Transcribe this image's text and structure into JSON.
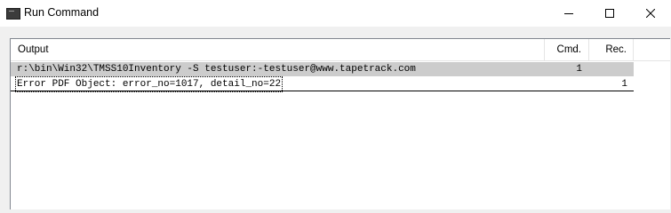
{
  "window": {
    "title": "Run Command"
  },
  "table": {
    "columns": [
      "Output",
      "Cmd.",
      "Rec."
    ],
    "rows": [
      {
        "output": "r:\\bin\\Win32\\TMSS10Inventory -S testuser:-testuser@www.tapetrack.com",
        "cmd": "1",
        "rec": ""
      },
      {
        "output": "Error PDF Object: error_no=1017, detail_no=22",
        "cmd": "",
        "rec": "1"
      }
    ]
  }
}
